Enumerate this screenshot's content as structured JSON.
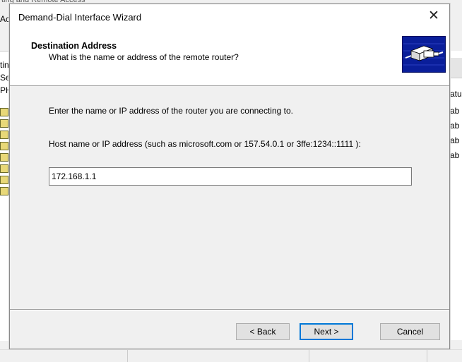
{
  "background_window": {
    "title_fragment": "ting and Remote Access",
    "menu_fragment": "Act",
    "tree_fragments": [
      "tin",
      "Ser",
      "PH"
    ],
    "right_column_header": "atu",
    "right_column_values": [
      "ab",
      "ab",
      "ab",
      "ab"
    ]
  },
  "wizard": {
    "title": "Demand-Dial Interface Wizard",
    "close_glyph": "✕",
    "header": {
      "title": "Destination Address",
      "subtitle": "What is the name or address of the remote router?",
      "icon": "router-connection-icon"
    },
    "instruction": "Enter the name or IP address of the router you are connecting to.",
    "field_label": "Host name or IP address (such as microsoft.com or 157.54.0.1 or 3ffe:1234::1111 ):",
    "host_value": "172.168.1.1",
    "buttons": {
      "back": "< Back",
      "next": "Next >",
      "cancel": "Cancel"
    }
  },
  "colors": {
    "next_button_border": "#0078d7",
    "header_icon_background": "#0a1e9a"
  }
}
